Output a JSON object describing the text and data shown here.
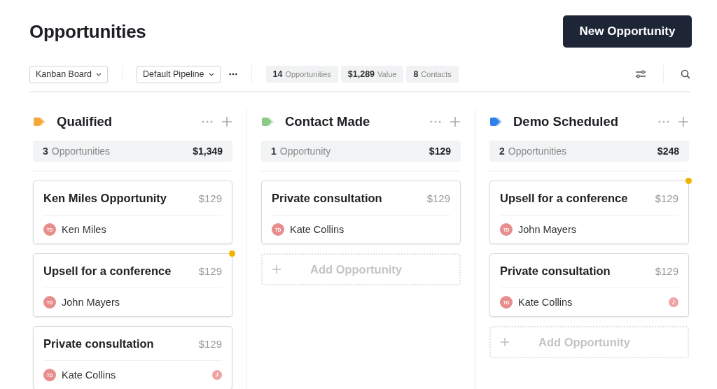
{
  "page": {
    "title": "Opportunities",
    "new_button": "New Opportunity"
  },
  "toolbar": {
    "view": "Kanban Board",
    "pipeline": "Default Pipeline",
    "stats": [
      {
        "value": "14",
        "label": "Opportunities"
      },
      {
        "value": "$1,289",
        "label": "Value"
      },
      {
        "value": "8",
        "label": "Contacts"
      }
    ]
  },
  "columns": [
    {
      "name": "Qualified",
      "color": "#f5a83a",
      "count": "3",
      "count_label": "Opportunities",
      "total": "$1,349",
      "cards": [
        {
          "title": "Ken Miles Opportunity",
          "amount": "$129",
          "initials": "TD",
          "contact": "Ken Miles",
          "flagged": false,
          "reminder": false
        },
        {
          "title": "Upsell for a conference",
          "amount": "$129",
          "initials": "TD",
          "contact": "John Mayers",
          "flagged": true,
          "reminder": false
        },
        {
          "title": "Private consultation",
          "amount": "$129",
          "initials": "TD",
          "contact": "Kate Collins",
          "flagged": false,
          "reminder": true
        }
      ]
    },
    {
      "name": "Contact Made",
      "color": "#8ccb86",
      "count": "1",
      "count_label": "Opportunity",
      "total": "$129",
      "cards": [
        {
          "title": "Private consultation",
          "amount": "$129",
          "initials": "TD",
          "contact": "Kate Collins",
          "flagged": false,
          "reminder": false
        }
      ],
      "add_button": "Add Opportunity"
    },
    {
      "name": "Demo Scheduled",
      "color": "#2f80ed",
      "count": "2",
      "count_label": "Opportunities",
      "total": "$248",
      "cards": [
        {
          "title": "Upsell for a conference",
          "amount": "$129",
          "initials": "TD",
          "contact": "John Mayers",
          "flagged": true,
          "reminder": false
        },
        {
          "title": "Private consultation",
          "amount": "$129",
          "initials": "TD",
          "contact": "Kate Collins",
          "flagged": false,
          "reminder": true
        }
      ],
      "add_button": "Add Opportunity"
    }
  ]
}
